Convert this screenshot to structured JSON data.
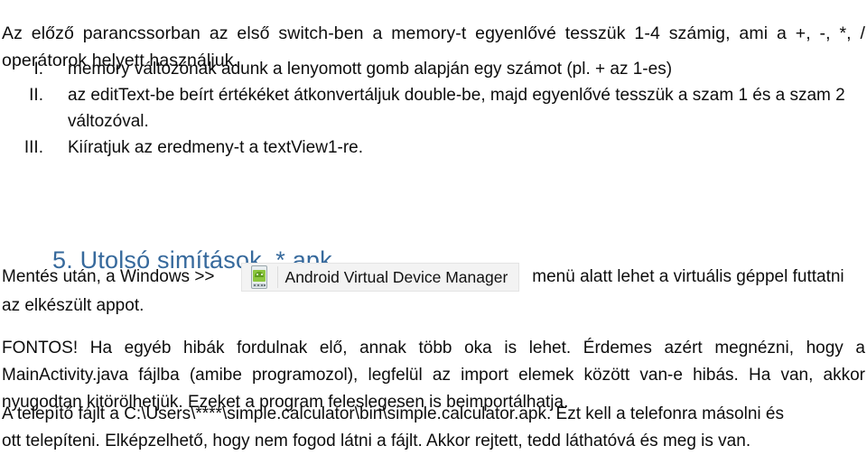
{
  "document": {
    "intro_paragraph": "Az előző parancssorban az első switch-ben a memory-t egyenlővé tesszük 1-4 számig, ami a +, -, *, / operátorok helyett használjuk.",
    "list": {
      "items": [
        {
          "marker": "I.",
          "text": "memory változónak adunk a lenyomott gomb alapján egy számot (pl. + az 1-es)"
        },
        {
          "marker": "II.",
          "text": "az editText-be beírt értékéket átkonvertáljuk double-be, majd egyenlővé tesszük a szam 1 és a szam 2 változóval."
        },
        {
          "marker": "III.",
          "text": "Kiíratjuk az eredmeny-t a  textView1-re."
        }
      ]
    },
    "section_heading": "5.  Utolsó simítások, *.apk",
    "section_heading_color": "#36699c",
    "avd_paragraph": {
      "before_widget": "Mentés után, a Windows >>",
      "widget_label": "Android Virtual Device Manager",
      "widget_icon": "android-virtual-device-icon",
      "after_widget": "menü alatt lehet a virtuális géppel futtatni",
      "second_line": "az elkészült appot."
    },
    "fontos_paragraph": "FONTOS! Ha egyéb hibák fordulnak elő, annak több oka is lehet. Érdemes azért megnézni, hogy a MainActivity.java fájlba (amibe programozol), legfelül az import elemek között van-e hibás. Ha van, akkor nyugodtan kitörölhetjük. Ezeket a program feleslegesen is beimportálhatja.",
    "installer_paragraph_line1": "A telepítő fájlt a C:\\Users\\****\\simple.calculator\\bin\\simple.calculator.apk. Ezt kell a telefonra másolni és",
    "installer_paragraph_line2": "ott telepíteni. Elképzelhető, hogy nem fogod látni a fájlt. Akkor rejtett, tedd láthatóvá és meg is van."
  }
}
